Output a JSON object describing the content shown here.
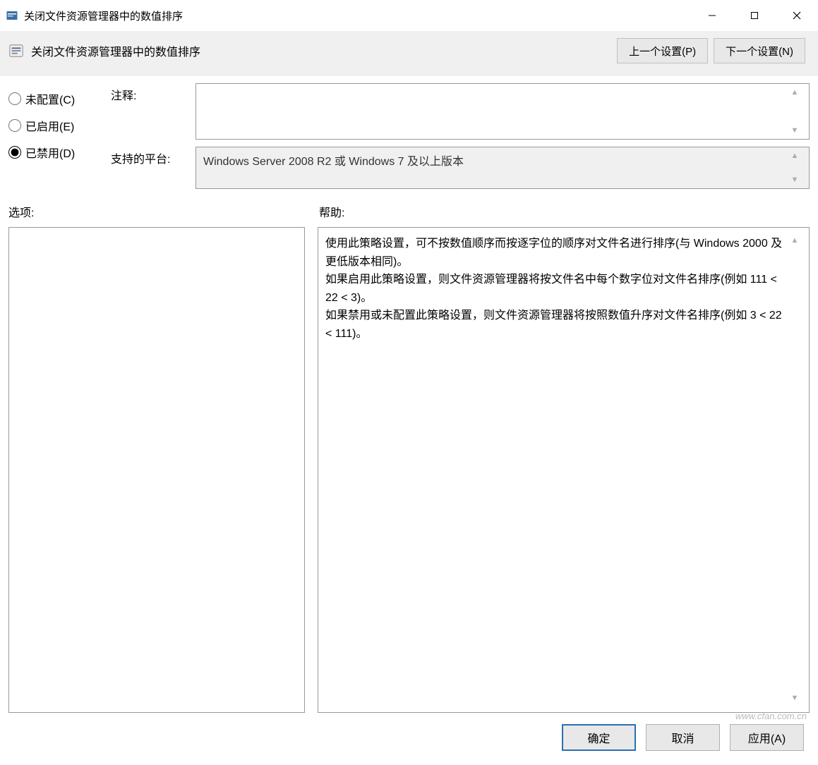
{
  "window": {
    "title": "关闭文件资源管理器中的数值排序"
  },
  "header": {
    "title": "关闭文件资源管理器中的数值排序",
    "prev_btn": "上一个设置(P)",
    "next_btn": "下一个设置(N)"
  },
  "radios": {
    "not_configured": "未配置(C)",
    "enabled": "已启用(E)",
    "disabled": "已禁用(D)",
    "selected": "disabled"
  },
  "fields": {
    "comment_label": "注释:",
    "comment_value": "",
    "supported_label": "支持的平台:",
    "supported_value": "Windows Server 2008 R2 或 Windows 7 及以上版本"
  },
  "sections": {
    "options_label": "选项:",
    "help_label": "帮助:"
  },
  "help_text": "使用此策略设置，可不按数值顺序而按逐字位的顺序对文件名进行排序(与 Windows 2000 及更低版本相同)。\n如果启用此策略设置，则文件资源管理器将按文件名中每个数字位对文件名排序(例如 111 < 22 < 3)。\n如果禁用或未配置此策略设置，则文件资源管理器将按照数值升序对文件名排序(例如 3 < 22 < 111)。",
  "footer": {
    "ok": "确定",
    "cancel": "取消",
    "apply": "应用(A)"
  },
  "watermark": "www.cfan.com.cn"
}
